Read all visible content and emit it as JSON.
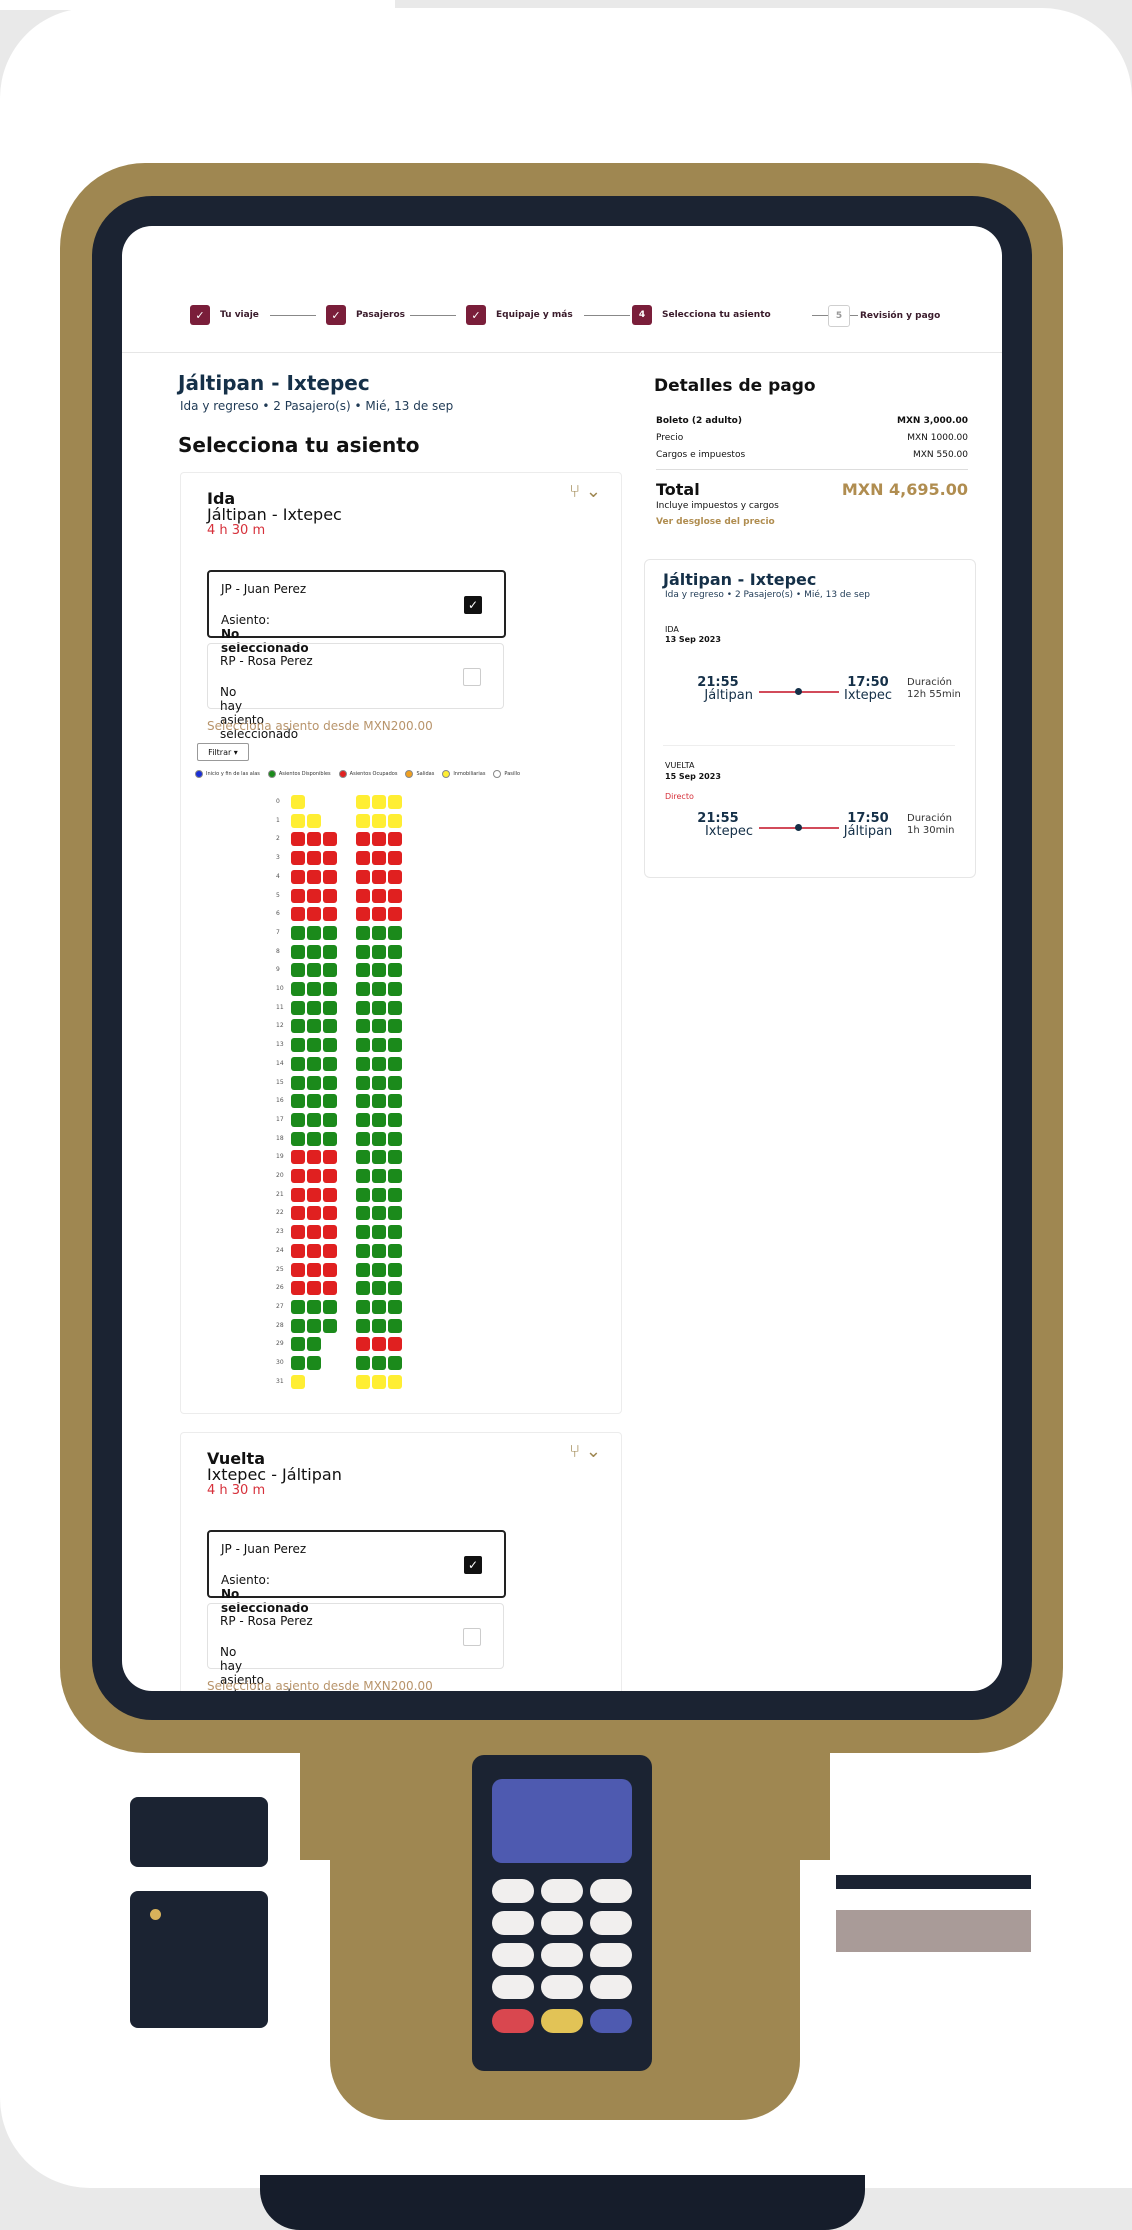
{
  "stepper": [
    {
      "label": "Tu viaje",
      "state": "done",
      "mark": "✓"
    },
    {
      "label": "Pasajeros",
      "state": "done",
      "mark": "✓"
    },
    {
      "label": "Equipaje y más",
      "state": "done",
      "mark": "✓"
    },
    {
      "label": "Selecciona tu asiento",
      "state": "current",
      "mark": "4"
    },
    {
      "label": "Revisión y pago",
      "state": "pending",
      "mark": "5"
    }
  ],
  "header": {
    "route": "Jáltipan - Ixtepec",
    "sub": "Ida y regreso  •  2 Pasajero(s)  •  Mié, 13 de sep",
    "section_title": "Selecciona tu asiento"
  },
  "legs": [
    {
      "label": "Ida",
      "route": "Jáltipan - Ixtepec",
      "duration": "4 h 30 m",
      "passengers": [
        {
          "name": "JP - Juan Perez",
          "seat_prefix": "Asiento: ",
          "seat_value": "No seleccionado",
          "checked": true
        },
        {
          "name": "RP - Rosa Perez",
          "seat_prefix": "",
          "seat_value": "No hay asiento seleccionado",
          "checked": false
        }
      ],
      "from_price": "Selecciona asiento desde MXN200.00",
      "filter": "Filtrar ▾"
    },
    {
      "label": "Vuelta",
      "route": "Ixtepec - Jáltipan",
      "duration": "4 h 30 m",
      "passengers": [
        {
          "name": "JP - Juan Perez",
          "seat_prefix": "Asiento: ",
          "seat_value": "No seleccionado",
          "checked": true
        },
        {
          "name": "RP - Rosa Perez",
          "seat_prefix": "",
          "seat_value": "No hay asiento seleccionado",
          "checked": false
        }
      ],
      "from_price": "Selecciona asiento desde MXN200.00"
    }
  ],
  "legend": [
    {
      "label": "Inicio y fin de las alas",
      "color": "#1a2fd6"
    },
    {
      "label": "Asientos Disponibles",
      "color": "#1b8a1b"
    },
    {
      "label": "Asientos Ocupados",
      "color": "#e02020"
    },
    {
      "label": "Salidas",
      "color": "#f0a020"
    },
    {
      "label": "Inmobiliarias",
      "color": "#ffee33"
    },
    {
      "label": "Pasillo",
      "color": "#ffffff"
    }
  ],
  "payment": {
    "title": "Detalles de pago",
    "rows": [
      {
        "label": "Boleto (2 adulto)",
        "value": "MXN 3,000.00",
        "bold": true
      },
      {
        "label": "Precio",
        "value": "MXN 1000.00",
        "bold": false
      },
      {
        "label": "Cargos e impuestos",
        "value": "MXN 550.00",
        "bold": false
      }
    ],
    "total_label": "Total",
    "total_value": "MXN 4,695.00",
    "includes": "Incluye impuestos y cargos",
    "breakdown_link": "Ver desglose del precio"
  },
  "trip_card": {
    "title": "Jáltipan - Ixtepec",
    "sub": "Ida y regreso  •  2 Pasajero(s)  •  Mié, 13 de sep",
    "outbound": {
      "label": "IDA",
      "date": "13 Sep 2023",
      "dep_time": "21:55",
      "dep_city": "Jáltipan",
      "arr_time": "17:50",
      "arr_city": "Ixtepec",
      "dur_label": "Duración",
      "dur": "12h 55min"
    },
    "return": {
      "label": "VUELTA",
      "date": "15 Sep 2023",
      "tag": "Directo",
      "dep_time": "21:55",
      "dep_city": "Ixtepec",
      "arr_time": "17:50",
      "arr_city": "Jáltipan",
      "dur_label": "Duración",
      "dur": "1h 30min"
    }
  },
  "colors": {
    "accent": "#7a1e3a",
    "gold": "#9f8751",
    "navy": "#153048",
    "red": "#d6303a"
  },
  "icons": {
    "seat": "seat-icon",
    "chevron": "chevron-down-icon",
    "check": "check-icon"
  }
}
